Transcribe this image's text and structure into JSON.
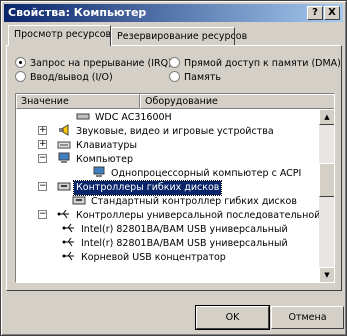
{
  "window": {
    "title": "Свойства: Компьютер",
    "help_label": "?",
    "close_label": "X"
  },
  "tabs": [
    {
      "label": "Просмотр ресурсов"
    },
    {
      "label": "Резервирование ресурсов"
    }
  ],
  "radios": [
    {
      "label": "Запрос на прерывание (IRQ)",
      "selected": true
    },
    {
      "label": "Прямой доступ к памяти (DMA)",
      "selected": false
    },
    {
      "label": "Ввод/вывод (I/O)",
      "selected": false
    },
    {
      "label": "Память",
      "selected": false
    }
  ],
  "columns": {
    "setting": "Значение",
    "hardware": "Оборудование"
  },
  "tree": [
    {
      "label": "WDC AC31600H"
    },
    {
      "label": "Звуковые, видео и игровые устройства"
    },
    {
      "label": "Клавиатуры"
    },
    {
      "label": "Компьютер"
    },
    {
      "label": "Однопроцессорный компьютер с ACPI"
    },
    {
      "label": "Контроллеры гибких дисков",
      "selected": true
    },
    {
      "label": "Стандартный контроллер гибких дисков"
    },
    {
      "label": "Контроллеры универсальной последовательной"
    },
    {
      "label": "Intel(r) 82801BA/BAM USB универсальный"
    },
    {
      "label": "Intel(r) 82801BA/BAM USB универсальный"
    },
    {
      "label": "Корневой USB концентратор"
    }
  ],
  "buttons": {
    "ok": "OK",
    "cancel": "Отмена"
  }
}
